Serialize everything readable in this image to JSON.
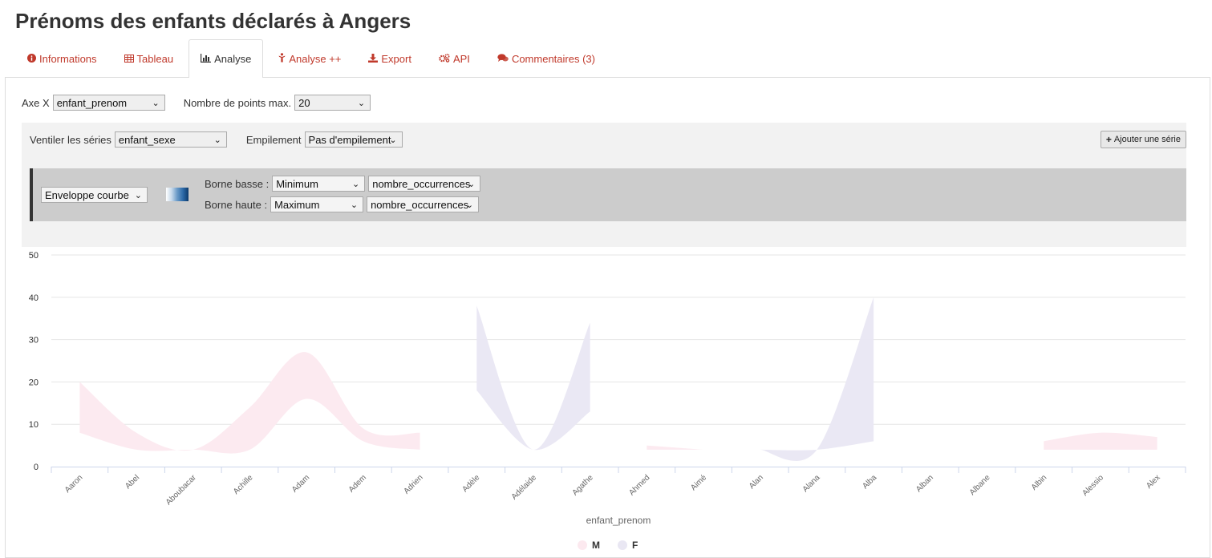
{
  "page": {
    "title": "Prénoms des enfants déclarés à Angers"
  },
  "tabs": [
    {
      "label": "Informations",
      "icon": "info-circle-icon"
    },
    {
      "label": "Tableau",
      "icon": "table-icon"
    },
    {
      "label": "Analyse",
      "icon": "bar-chart-icon",
      "active": true
    },
    {
      "label": "Analyse ++",
      "icon": "child-icon"
    },
    {
      "label": "Export",
      "icon": "download-icon"
    },
    {
      "label": "API",
      "icon": "gears-icon"
    },
    {
      "label": "Commentaires (3)",
      "icon": "comments-icon"
    }
  ],
  "controls": {
    "axe_x_label": "Axe X",
    "axe_x_value": "enfant_prenom",
    "max_points_label": "Nombre de points max.",
    "max_points_value": "20",
    "ventiler_label": "Ventiler les séries",
    "ventiler_value": "enfant_sexe",
    "empilement_label": "Empilement",
    "empilement_value": "Pas d'empilement",
    "add_series_label": "Ajouter une série"
  },
  "series_config": {
    "type_value": "Enveloppe courbe",
    "borne_basse_label": "Borne basse :",
    "borne_basse_agg": "Minimum",
    "borne_basse_field": "nombre_occurrences",
    "borne_haute_label": "Borne haute :",
    "borne_haute_agg": "Maximum",
    "borne_haute_field": "nombre_occurrences"
  },
  "colors": {
    "accent": "#c0392b",
    "series_m": "#fce9ef",
    "series_f": "#e9e7f3"
  },
  "chart_data": {
    "type": "area",
    "subtype": "range-envelope",
    "xlabel": "enfant_prenom",
    "ylim": [
      0,
      50
    ],
    "yticks": [
      0,
      10,
      20,
      30,
      40,
      50
    ],
    "categories": [
      "Aaron",
      "Abel",
      "Aboubacar",
      "Achille",
      "Adam",
      "Adem",
      "Adrien",
      "Adèle",
      "Adélaide",
      "Agathe",
      "Ahmed",
      "Aimé",
      "Alan",
      "Alana",
      "Alba",
      "Alban",
      "Albane",
      "Albin",
      "Alessio",
      "Alex"
    ],
    "series": [
      {
        "name": "M",
        "color": "#fce9ef",
        "low": [
          8,
          4,
          4,
          4,
          16,
          6,
          4,
          null,
          null,
          null,
          4,
          4,
          null,
          null,
          null,
          null,
          null,
          4,
          4,
          4
        ],
        "high": [
          20,
          8,
          4,
          14,
          27,
          9,
          8,
          null,
          null,
          null,
          5,
          4,
          null,
          null,
          null,
          null,
          null,
          6,
          8,
          7
        ]
      },
      {
        "name": "F",
        "color": "#e9e7f3",
        "low": [
          null,
          null,
          null,
          null,
          null,
          null,
          null,
          18,
          4,
          13,
          null,
          null,
          4,
          4,
          6,
          null,
          null,
          null,
          null,
          null
        ],
        "high": [
          null,
          null,
          null,
          null,
          null,
          null,
          null,
          38,
          4,
          34,
          null,
          null,
          4,
          4,
          40,
          null,
          null,
          null,
          null,
          null
        ]
      }
    ],
    "legend": [
      "M",
      "F"
    ],
    "legend_position": "bottom-center",
    "grid": true
  }
}
